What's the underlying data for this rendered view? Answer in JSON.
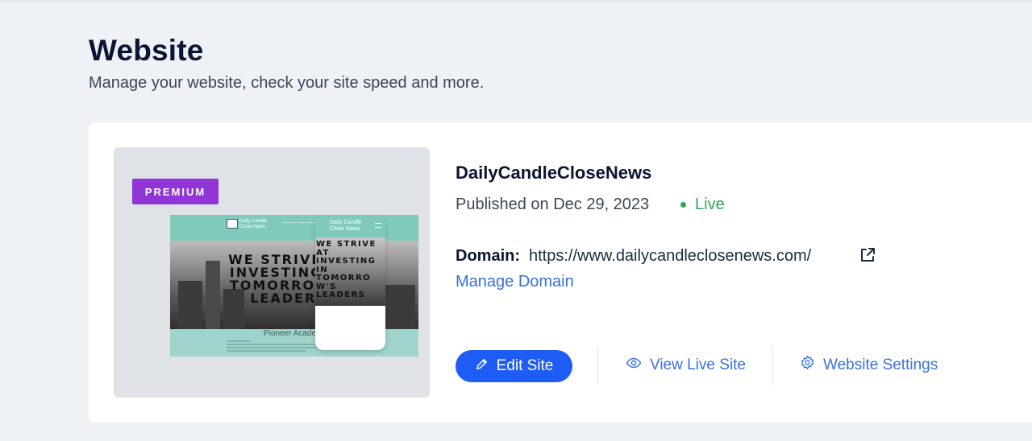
{
  "page": {
    "title": "Website",
    "subtitle": "Manage your website, check your site speed and more."
  },
  "preview": {
    "badge": "PREMIUM",
    "desktop_brand": "Daily Candle Close News",
    "hero_text": "WE STRIVE AT INVESTING IN TOMORROW'S LEADERS",
    "footer_title": "Pioneer Academy",
    "mobile_brand": "Daily Candle Close News",
    "mobile_hero_text": "WE STRIVE\nAT\nINVESTING\nIN\nTOMORRO\nW'S\nLEADERS"
  },
  "site": {
    "name": "DailyCandleCloseNews",
    "published": "Published on Dec 29, 2023",
    "status": "Live",
    "domain_label": "Domain:",
    "domain_url": "https://www.dailycandleclosenews.com/",
    "manage_domain": "Manage Domain"
  },
  "actions": {
    "edit": "Edit Site",
    "view_live": "View Live Site",
    "settings": "Website Settings"
  },
  "colors": {
    "accent": "#1d5cf5",
    "link": "#3870e0",
    "live": "#2fa85a",
    "premium": "#9135d6"
  },
  "icons": {
    "edit": "pencil-icon",
    "view": "eye-icon",
    "settings": "gear-icon",
    "external": "external-link-icon"
  }
}
